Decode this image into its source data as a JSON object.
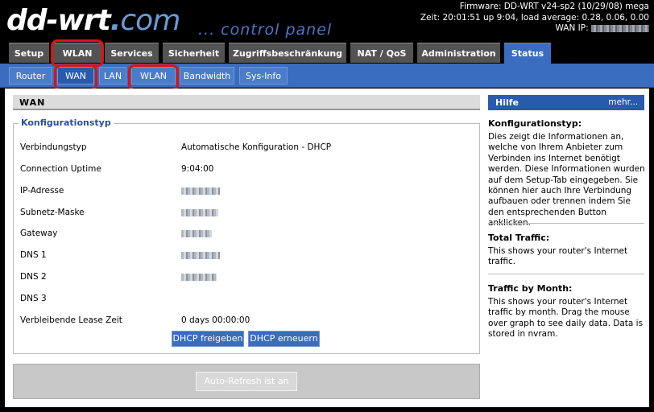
{
  "header": {
    "logo_main": "dd-wrt",
    "logo_dot": ".",
    "logo_com": "com",
    "tagline": "... control panel",
    "firmware": "Firmware: DD-WRT v24-sp2 (10/29/08) mega",
    "time": "Zeit: 20:01:51 up 9:04, load average: 0.28, 0.06, 0.00",
    "wan_ip_label": "WAN IP:"
  },
  "main_tabs": [
    "Setup",
    "WLAN",
    "Services",
    "Sicherheit",
    "Zugriffsbeschränkung",
    "NAT / QoS",
    "Administration",
    "Status"
  ],
  "sub_tabs": [
    "Router",
    "WAN",
    "LAN",
    "WLAN",
    "Bandwidth",
    "Sys-Info"
  ],
  "section_title": "WAN",
  "legend": "Konfigurationstyp",
  "rows": [
    {
      "label": "Verbindungstyp",
      "value": "Automatische Konfiguration - DHCP"
    },
    {
      "label": "Connection Uptime",
      "value": "9:04:00"
    },
    {
      "label": "IP-Adresse",
      "value": ""
    },
    {
      "label": "Subnetz-Maske",
      "value": ""
    },
    {
      "label": "Gateway",
      "value": ""
    },
    {
      "label": "DNS 1",
      "value": ""
    },
    {
      "label": "DNS 2",
      "value": ""
    },
    {
      "label": "DNS 3",
      "value": ""
    },
    {
      "label": "Verbleibende Lease Zeit",
      "value": "0 days 00:00:00"
    }
  ],
  "buttons": {
    "release": "DHCP freigeben",
    "renew": "DHCP erneuern",
    "autorefresh": "Auto-Refresh ist an"
  },
  "help": {
    "title": "Hilfe",
    "more": "mehr...",
    "s1_title": "Konfigurationstyp:",
    "s1_text": "Dies zeigt die Informationen an, welche von Ihrem Anbieter zum Verbinden ins Internet benötigt werden. Diese Informationen wurden auf dem Setup-Tab eingegeben. Sie können hier auch Ihre Verbindung aufbauen oder trennen indem Sie den entsprechenden Button anklicken.",
    "s2_title": "Total Traffic:",
    "s2_text": "This shows your router's Internet traffic.",
    "s3_title": "Traffic by Month:",
    "s3_text": "This shows your router's Internet traffic by month. Drag the mouse over graph to see daily data. Data is stored in nvram."
  },
  "colors": {
    "accent": "#3a6cc0",
    "highlight_ring": "#e01010",
    "tab_inactive": "#535353"
  }
}
